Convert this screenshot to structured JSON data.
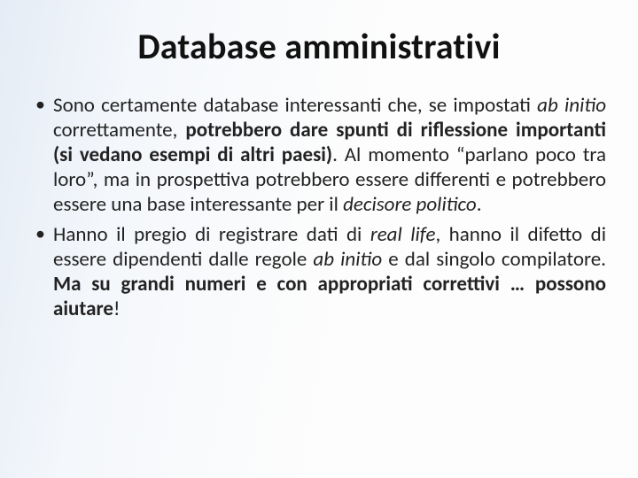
{
  "title": "Database amministrativi",
  "bullets": [
    {
      "runs": [
        {
          "t": "Sono certamente database interessanti che, se impostati ",
          "c": ""
        },
        {
          "t": "ab initio",
          "c": "i"
        },
        {
          "t": " correttamente, ",
          "c": ""
        },
        {
          "t": "potrebbero dare spunti di riflessione importanti (si vedano esempi di altri paesi)",
          "c": "b"
        },
        {
          "t": ". Al momento “parlano poco tra loro”, ma in prospettiva potrebbero essere differenti e potrebbero essere una base interessante per il ",
          "c": ""
        },
        {
          "t": "decisore politico",
          "c": "i"
        },
        {
          "t": ".",
          "c": ""
        }
      ]
    },
    {
      "runs": [
        {
          "t": "Hanno il pregio di registrare dati di ",
          "c": ""
        },
        {
          "t": "real life",
          "c": "i"
        },
        {
          "t": ", hanno il difetto di essere dipendenti dalle regole ",
          "c": ""
        },
        {
          "t": "ab initio",
          "c": "i"
        },
        {
          "t": " e dal singolo compilatore. ",
          "c": ""
        },
        {
          "t": "Ma su grandi numeri e con appropriati correttivi … possono aiutare",
          "c": "b"
        },
        {
          "t": "!",
          "c": ""
        }
      ]
    }
  ]
}
